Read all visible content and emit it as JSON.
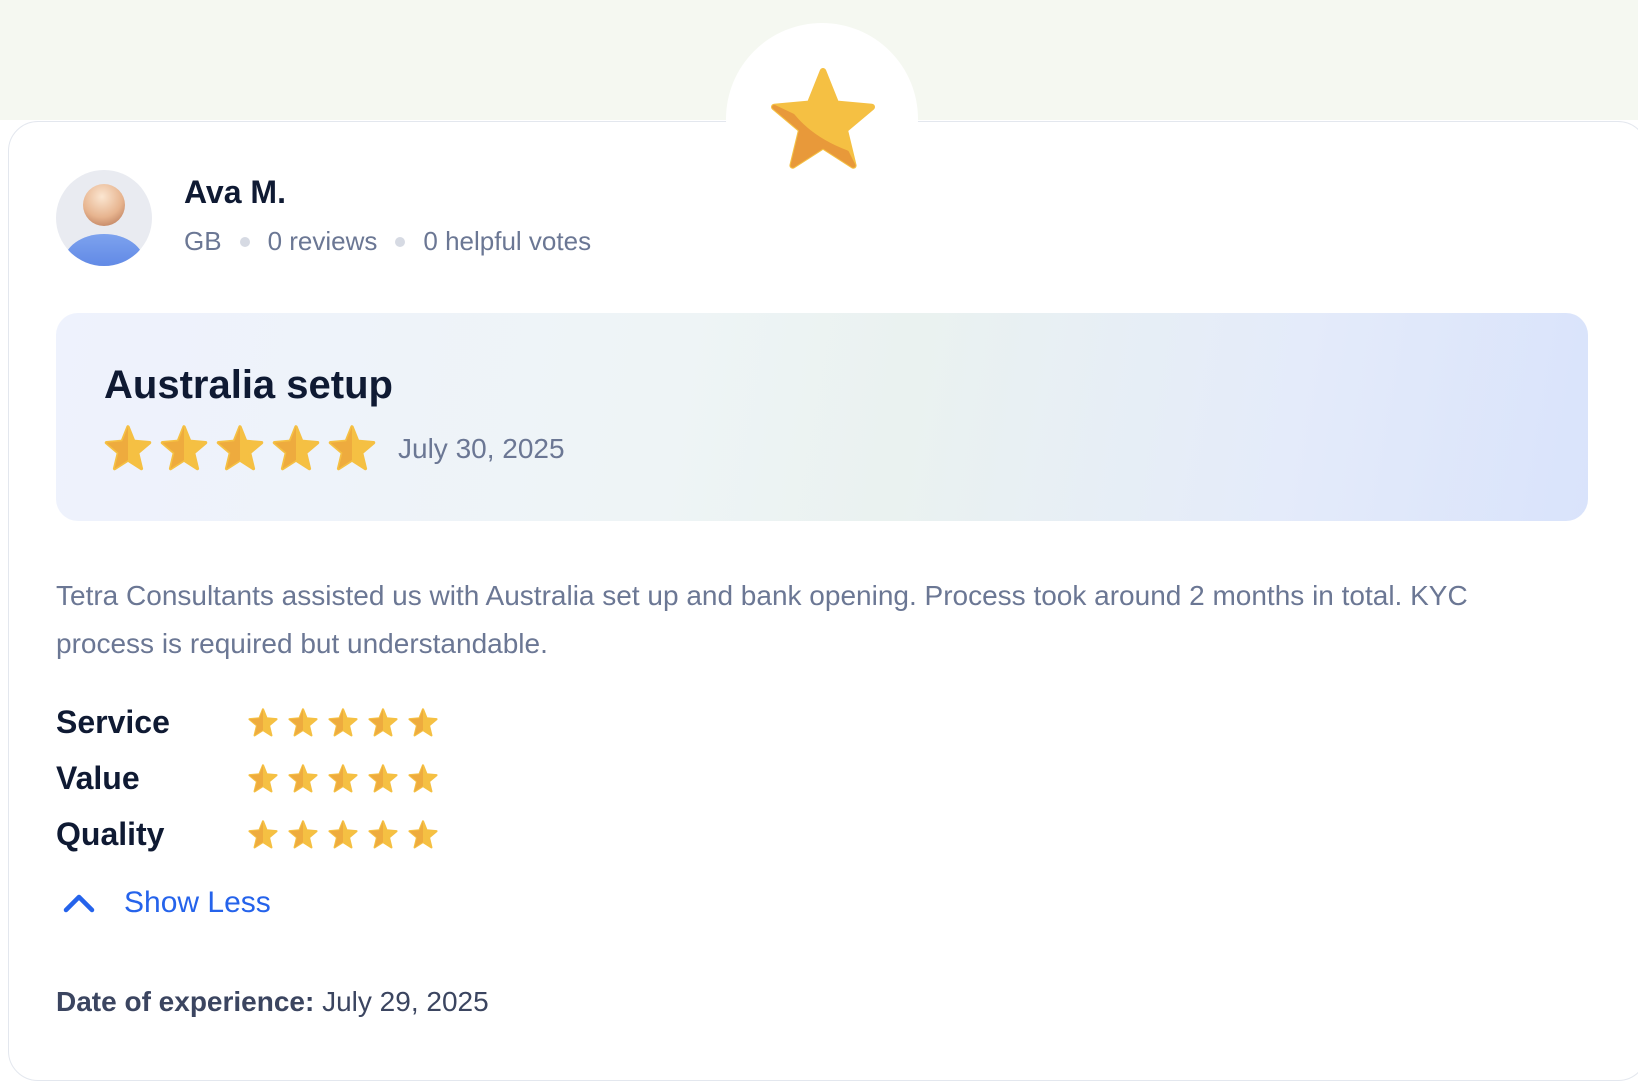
{
  "reviewer": {
    "name": "Ava M.",
    "country": "GB",
    "reviews": "0 reviews",
    "helpful_votes": "0 helpful votes"
  },
  "review": {
    "title": "Australia setup",
    "rating": 5,
    "date": "July 30, 2025",
    "body": "Tetra Consultants assisted us with Australia set up and bank opening. Process took around 2 months in total. KYC process is required but understandable."
  },
  "ratings": [
    {
      "label": "Service",
      "stars": 5
    },
    {
      "label": "Value",
      "stars": 5
    },
    {
      "label": "Quality",
      "stars": 5
    }
  ],
  "toggle": {
    "label": "Show Less"
  },
  "experience": {
    "label": "Date of experience:",
    "date": "July 29, 2025"
  },
  "colors": {
    "star": "#f5c043",
    "star_shade": "#e8993a",
    "link": "#2563eb",
    "heading": "#0f1a33",
    "muted": "#6b7794"
  },
  "icons": {
    "badge": "star-icon",
    "toggle": "chevron-up-icon",
    "avatar": "person-icon"
  }
}
